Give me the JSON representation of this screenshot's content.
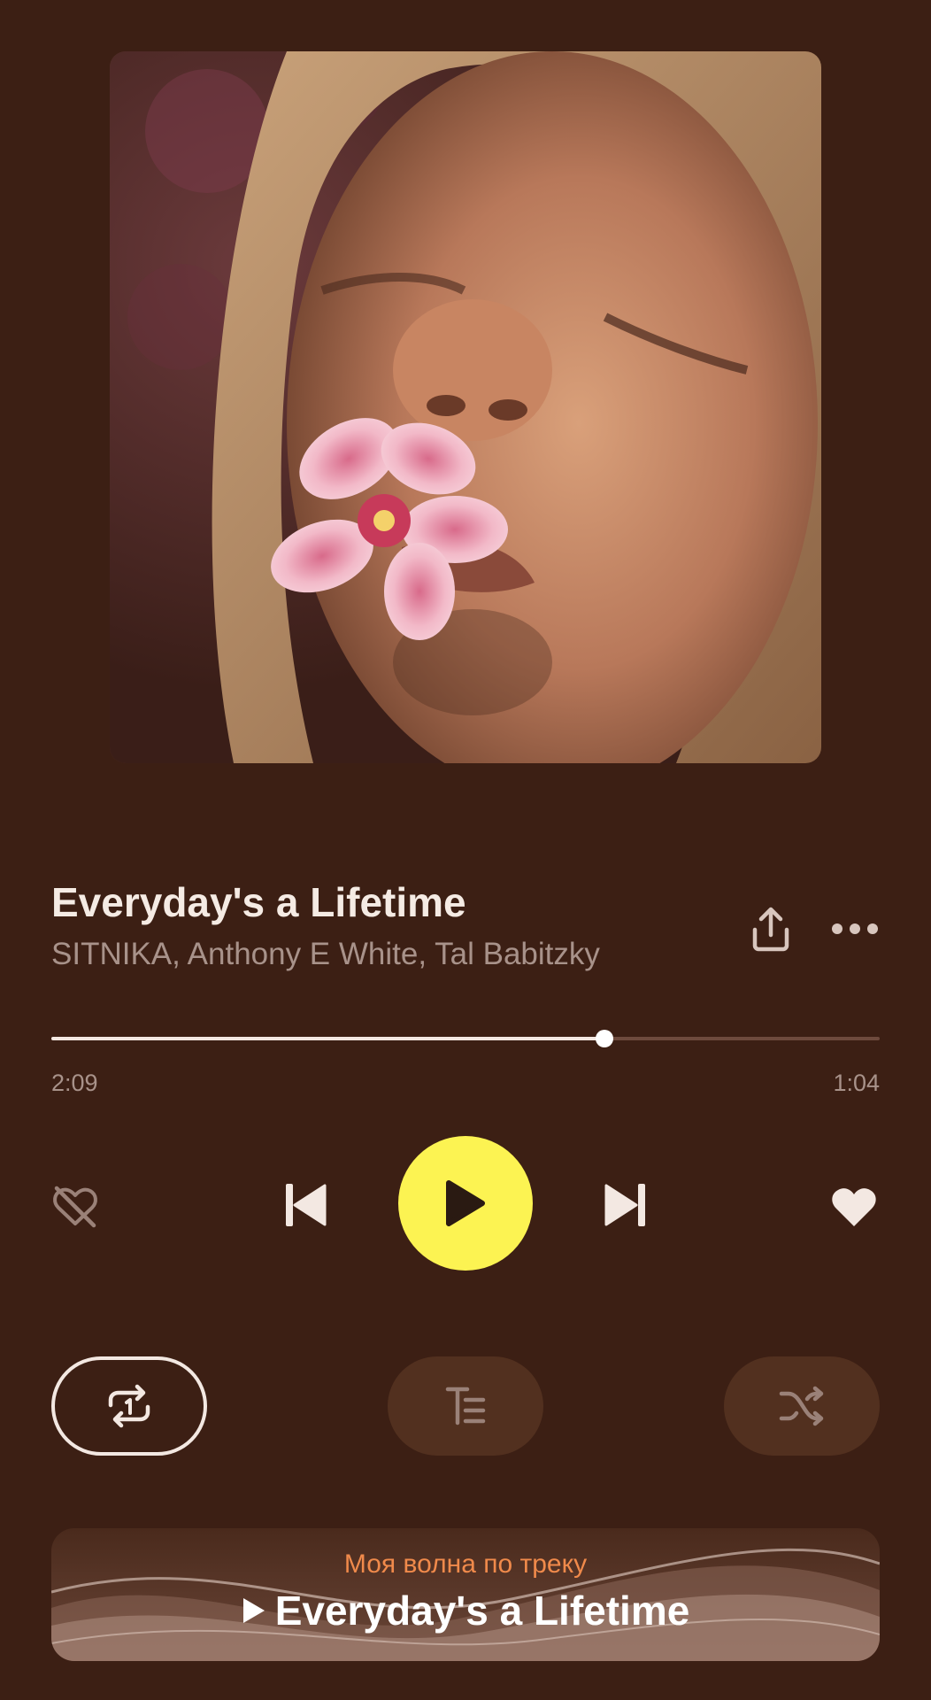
{
  "player": {
    "track_title": "Everyday's a Lifetime",
    "artists": "SITNIKA, Anthony E White, Tal Babitzky",
    "progress_fraction": 0.668,
    "time_elapsed": "2:09",
    "time_remaining": "1:04"
  },
  "icons": {
    "share": "share-icon",
    "more": "more-icon",
    "dislike": "dislike-icon",
    "previous": "previous-track-icon",
    "play": "play-icon",
    "next": "next-track-icon",
    "like": "heart-icon",
    "repeat": "repeat-one-icon",
    "lyrics_queue": "text-queue-icon",
    "shuffle": "shuffle-icon"
  },
  "wave": {
    "subtitle": "Моя волна по треку",
    "title": "Everyday's a Lifetime"
  },
  "colors": {
    "background": "#3c1f14",
    "play_button": "#fcf352",
    "accent_text": "#f08a4b",
    "secondary_text": "#a8928a"
  }
}
